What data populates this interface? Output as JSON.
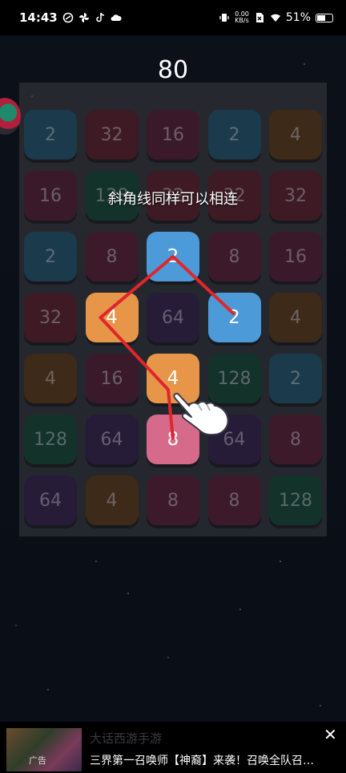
{
  "status_bar": {
    "time": "14:43",
    "net_speed_value": "0.00",
    "net_speed_unit": "KB/s",
    "battery": "51%"
  },
  "score": "80",
  "hint_text": "斜角线同样可以相连",
  "board": {
    "rows": [
      [
        {
          "value": "2",
          "color": "#1b3a4c",
          "active": false
        },
        {
          "value": "32",
          "color": "#3d1a24",
          "active": false
        },
        {
          "value": "16",
          "color": "#3a1a2a",
          "active": false
        },
        {
          "value": "2",
          "color": "#1b3a4c",
          "active": false
        },
        {
          "value": "4",
          "color": "#3d2a18",
          "active": false
        }
      ],
      [
        {
          "value": "16",
          "color": "#3a1a2a",
          "active": false
        },
        {
          "value": "128",
          "color": "#12322a",
          "active": false
        },
        {
          "value": "32",
          "color": "#3d1a24",
          "active": false
        },
        {
          "value": "32",
          "color": "#3d1a24",
          "active": false
        },
        {
          "value": "32",
          "color": "#3d1a24",
          "active": false
        }
      ],
      [
        {
          "value": "2",
          "color": "#1b3a4c",
          "active": false
        },
        {
          "value": "8",
          "color": "#3d1a2a",
          "active": false
        },
        {
          "value": "2",
          "color": "#4c9ad8",
          "active": true
        },
        {
          "value": "8",
          "color": "#3d1a2a",
          "active": false
        },
        {
          "value": "16",
          "color": "#3a1a2a",
          "active": false
        }
      ],
      [
        {
          "value": "32",
          "color": "#3d1a24",
          "active": false
        },
        {
          "value": "4",
          "color": "#e79548",
          "active": true
        },
        {
          "value": "64",
          "color": "#261c38",
          "active": false
        },
        {
          "value": "2",
          "color": "#4c9ad8",
          "active": true
        },
        {
          "value": "4",
          "color": "#3d2a18",
          "active": false
        }
      ],
      [
        {
          "value": "4",
          "color": "#3d2a18",
          "active": false
        },
        {
          "value": "16",
          "color": "#3a1a2a",
          "active": false
        },
        {
          "value": "4",
          "color": "#e79548",
          "active": true
        },
        {
          "value": "128",
          "color": "#12322a",
          "active": false
        },
        {
          "value": "2",
          "color": "#1b3a4c",
          "active": false
        }
      ],
      [
        {
          "value": "128",
          "color": "#12322a",
          "active": false
        },
        {
          "value": "64",
          "color": "#261c38",
          "active": false
        },
        {
          "value": "8",
          "color": "#d66a8a",
          "active": true
        },
        {
          "value": "64",
          "color": "#261c38",
          "active": false
        },
        {
          "value": "8",
          "color": "#3d1a2a",
          "active": false
        }
      ],
      [
        {
          "value": "64",
          "color": "#261c38",
          "active": false
        },
        {
          "value": "4",
          "color": "#3d2a18",
          "active": false
        },
        {
          "value": "8",
          "color": "#3d1a2a",
          "active": false
        },
        {
          "value": "8",
          "color": "#3d1a2a",
          "active": false
        },
        {
          "value": "128",
          "color": "#12322a",
          "active": false
        }
      ]
    ],
    "path_cells": [
      [
        3,
        3
      ],
      [
        2,
        2
      ],
      [
        3,
        1
      ],
      [
        4,
        2
      ],
      [
        5,
        2
      ]
    ],
    "line_color": "#e0262c"
  },
  "ad": {
    "tag": "广告",
    "title": "大话西游手游",
    "description": "三界第一召唤师【神裔】来袭！召唤全队召…",
    "close_icon": "close-icon"
  }
}
